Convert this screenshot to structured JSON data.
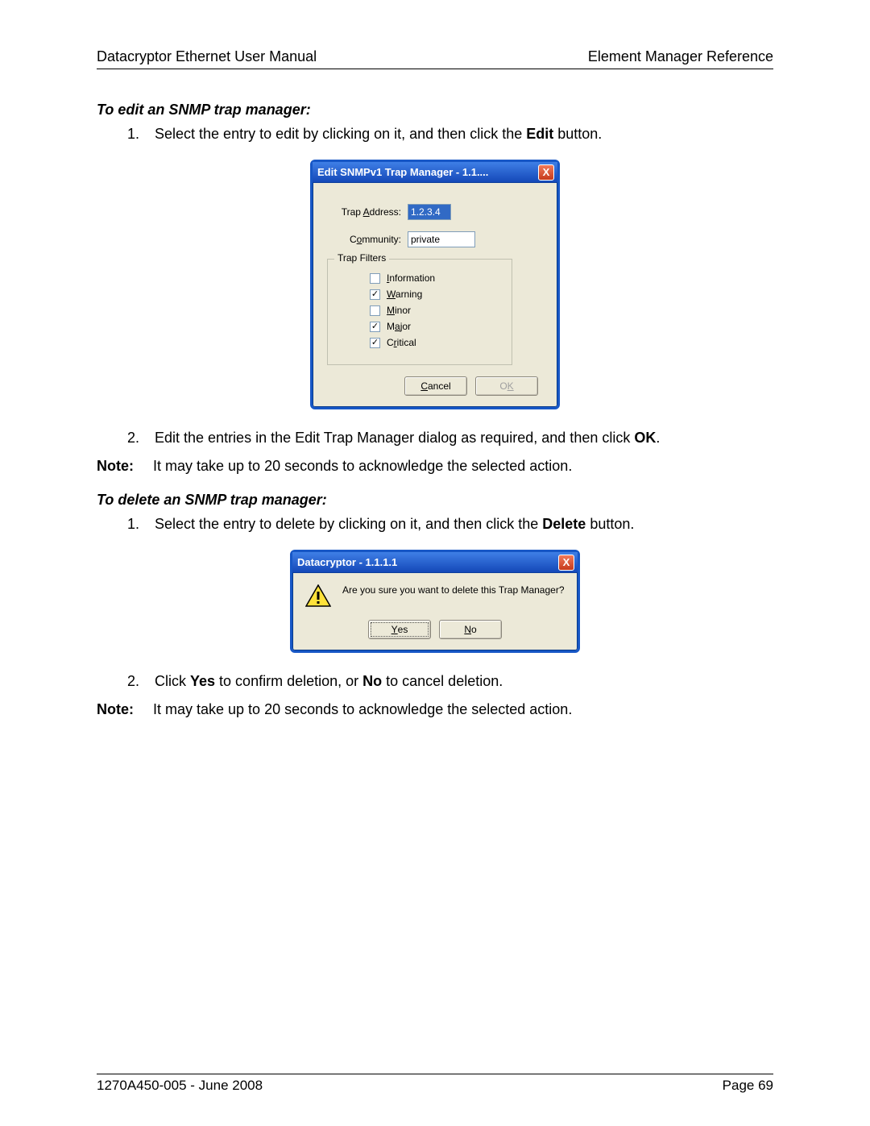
{
  "header": {
    "left": "Datacryptor Ethernet User Manual",
    "right": "Element Manager Reference"
  },
  "section1": {
    "heading": "To edit an SNMP trap manager:",
    "step1_pre": "Select the entry to edit by clicking on it, and then click the ",
    "step1_b": "Edit",
    "step1_post": " button.",
    "step2_pre": "Edit the entries in the Edit Trap Manager dialog as required, and then click ",
    "step2_b": "OK",
    "step2_post": ".",
    "note_label": "Note:",
    "note_text": "It may take up to 20 seconds to acknowledge the selected action."
  },
  "dialog_edit": {
    "title": "Edit SNMPv1 Trap Manager - 1.1....",
    "close_glyph": "X",
    "trap_addr_label_pre": "Trap ",
    "trap_addr_label_u": "A",
    "trap_addr_label_post": "ddress:",
    "trap_addr_value": "1.2.3.4",
    "community_label_pre": "C",
    "community_label_u": "o",
    "community_label_post": "mmunity:",
    "community_value": "private",
    "filters_legend": "Trap Filters",
    "filters": [
      {
        "u": "I",
        "post": "nformation",
        "checked": false
      },
      {
        "u": "W",
        "post": "arning",
        "checked": true
      },
      {
        "u": "M",
        "post": "inor",
        "checked": false
      },
      {
        "pre": "M",
        "u": "a",
        "post": "jor",
        "checked": true
      },
      {
        "pre": "C",
        "u": "r",
        "post": "itical",
        "checked": true
      }
    ],
    "cancel_u": "C",
    "cancel_post": "ancel",
    "ok_pre": "O",
    "ok_u": "K"
  },
  "section2": {
    "heading": "To delete an SNMP trap manager:",
    "step1_pre": "Select the entry to delete by clicking on it, and then click the ",
    "step1_b": "Delete",
    "step1_post": " button.",
    "step2_pre": "Click ",
    "step2_b1": "Yes",
    "step2_mid": " to confirm deletion, or ",
    "step2_b2": "No",
    "step2_post": " to cancel deletion.",
    "note_label": "Note:",
    "note_text": "It may take up to 20 seconds to acknowledge the selected action."
  },
  "dialog_confirm": {
    "title": "Datacryptor - 1.1.1.1",
    "close_glyph": "X",
    "message": "Are you sure you want to delete this Trap Manager?",
    "yes_u": "Y",
    "yes_post": "es",
    "no_u": "N",
    "no_post": "o"
  },
  "footer": {
    "left": "1270A450-005 - June 2008",
    "right": "Page 69"
  }
}
